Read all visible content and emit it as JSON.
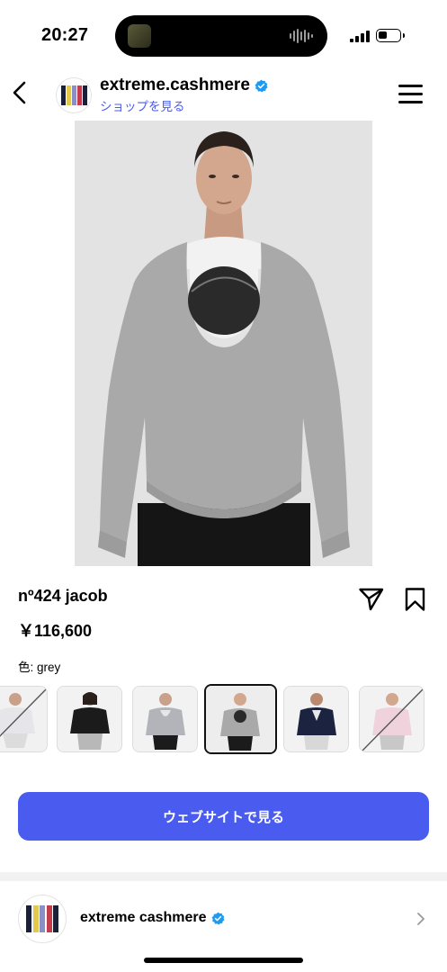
{
  "status_bar": {
    "time": "20:27",
    "battery_level": 0.45
  },
  "header": {
    "shop_name": "extreme.cashmere",
    "shop_link": "ショップを見る"
  },
  "brand_colors": {
    "accent": "#4a5cf0",
    "verified": "#1d9bf0",
    "logo_stripes": [
      "#1a1f3a",
      "#e2c84c",
      "#8a8fc7",
      "#c43c4c",
      "#1a1f3a"
    ]
  },
  "product": {
    "name": "nº424 jacob",
    "price": "￥116,600",
    "color_label": "色: grey"
  },
  "variants": [
    {
      "name": "white",
      "available": false
    },
    {
      "name": "black",
      "available": true
    },
    {
      "name": "light grey",
      "available": true
    },
    {
      "name": "grey",
      "available": true,
      "selected": true
    },
    {
      "name": "navy",
      "available": true
    },
    {
      "name": "pink",
      "available": false
    }
  ],
  "cta": {
    "label": "ウェブサイトで見る"
  },
  "shop_row": {
    "name": "extreme cashmere"
  },
  "icons": [
    "back-icon",
    "verified-icon",
    "menu-icon",
    "share-icon",
    "bookmark-icon",
    "chevron-right-icon"
  ]
}
